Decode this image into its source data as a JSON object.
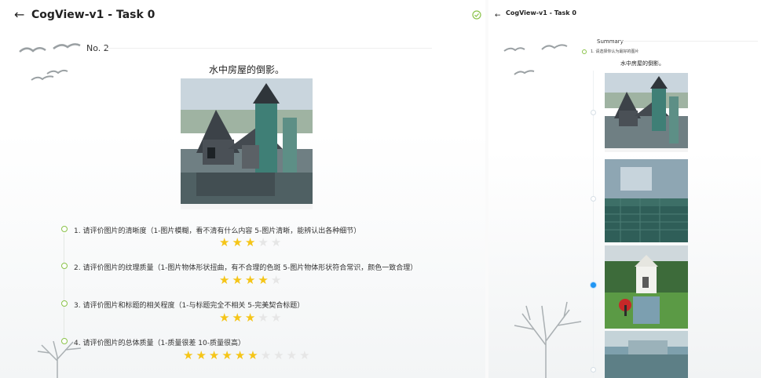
{
  "header": {
    "title": "CogView-v1 - Task 0",
    "back_icon": "←"
  },
  "left_panel": {
    "item_number": "No. 2",
    "caption": "水中房屋的倒影。",
    "questions": [
      {
        "label": "1. 请评价图片的清晰度（1-图片模糊，看不清有什么内容 5-图片清晰，能辨认出各种细节）",
        "rating": 3,
        "max": 5
      },
      {
        "label": "2. 请评价图片的纹理质量（1-图片物体形状扭曲，有不合理的色斑 5-图片物体形状符合常识，颜色一致合理）",
        "rating": 4,
        "max": 5
      },
      {
        "label": "3. 请评价图片和标题的相关程度（1-与标题完全不相关 5-完美契合标题）",
        "rating": 3,
        "max": 5
      },
      {
        "label": "4. 请评价图片的总体质量（1-质量很差 10-质量很高）",
        "rating": 6,
        "max": 10
      }
    ]
  },
  "right_panel": {
    "title": "CogView-v1 - Task 0",
    "summary_label": "Summary",
    "question": "1. 请选择你认为最好的图片",
    "caption": "水中房屋的倒影。",
    "options": [
      {
        "name": "candidate-1",
        "selected": false
      },
      {
        "name": "candidate-2",
        "selected": false
      },
      {
        "name": "candidate-3",
        "selected": true
      },
      {
        "name": "candidate-4",
        "selected": false
      }
    ]
  },
  "colors": {
    "accent_green": "#8bc34a",
    "star_on": "#f5c518",
    "star_off": "#e6e6e6",
    "radio_selected": "#2196f3"
  },
  "icons": {
    "back": "arrow-left-icon",
    "check": "check-circle-icon"
  }
}
